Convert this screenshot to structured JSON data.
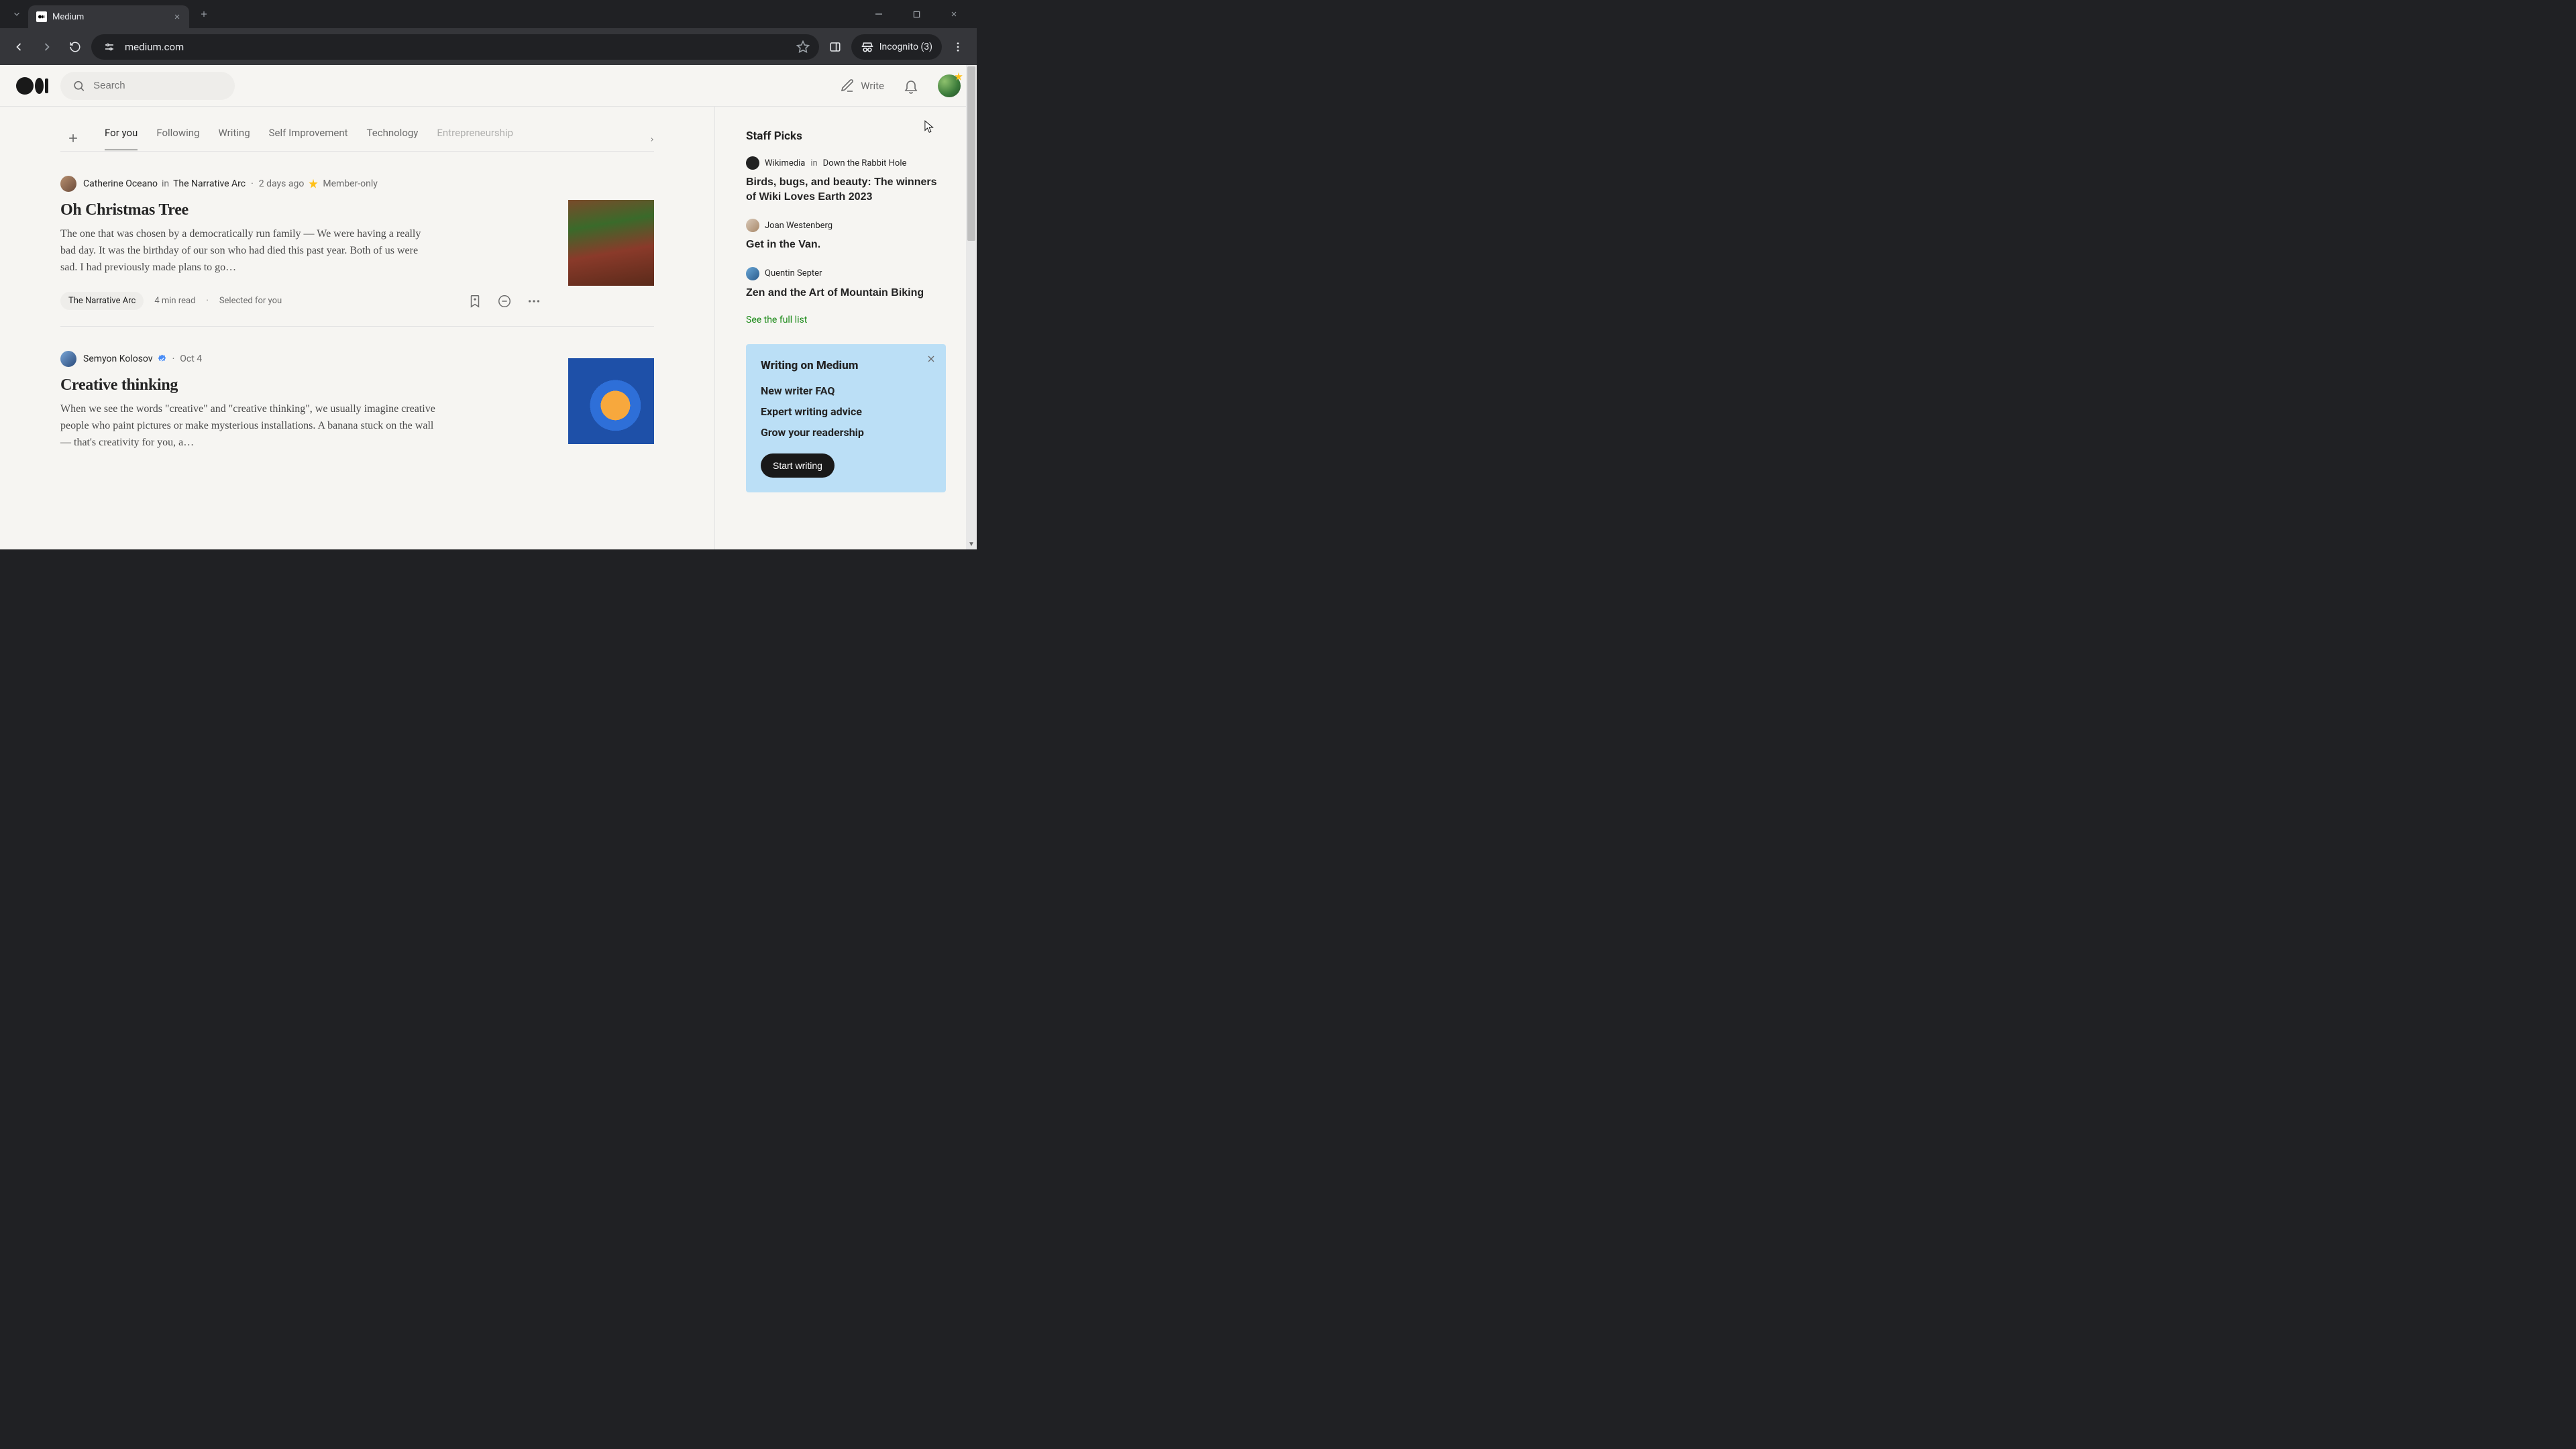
{
  "browser": {
    "tab_title": "Medium",
    "url": "medium.com",
    "incognito_label": "Incognito (3)"
  },
  "header": {
    "search_placeholder": "Search",
    "write_label": "Write"
  },
  "nav": {
    "tabs": [
      "For you",
      "Following",
      "Writing",
      "Self Improvement",
      "Technology",
      "Entrepreneurship"
    ],
    "active_index": 0
  },
  "feed": [
    {
      "author": "Catherine Oceano",
      "in_word": "in",
      "publication": "The Narrative Arc",
      "date": "2 days ago",
      "member_only_label": "Member-only",
      "title": "Oh Christmas Tree",
      "excerpt": "The one that was chosen by a democratically run family — We were having a really bad day. It was the birthday of our son who had died this past year. Both of us were sad. I had previously made plans to go…",
      "topic": "The Narrative Arc",
      "read_time": "4 min read",
      "selected_for_you": "Selected for you"
    },
    {
      "author": "Semyon Kolosov",
      "date": "Oct 4",
      "title": "Creative thinking",
      "excerpt": "When we see the words \"creative\" and \"creative thinking\", we usually imagine creative people who paint pictures or make mysterious installations. A banana stuck on the wall — that's creativity for you, a…"
    }
  ],
  "staff_picks": {
    "heading": "Staff Picks",
    "items": [
      {
        "byline_name": "Wikimedia",
        "byline_in": "in",
        "byline_pub": "Down the Rabbit Hole",
        "title": "Birds, bugs, and beauty: The winners of Wiki Loves Earth 2023"
      },
      {
        "byline_name": "Joan Westenberg",
        "title": "Get in the Van."
      },
      {
        "byline_name": "Quentin Septer",
        "title": "Zen and the Art of Mountain Biking"
      }
    ],
    "see_full": "See the full list"
  },
  "writing_panel": {
    "heading": "Writing on Medium",
    "links": [
      "New writer FAQ",
      "Expert writing advice",
      "Grow your readership"
    ],
    "cta": "Start writing"
  }
}
